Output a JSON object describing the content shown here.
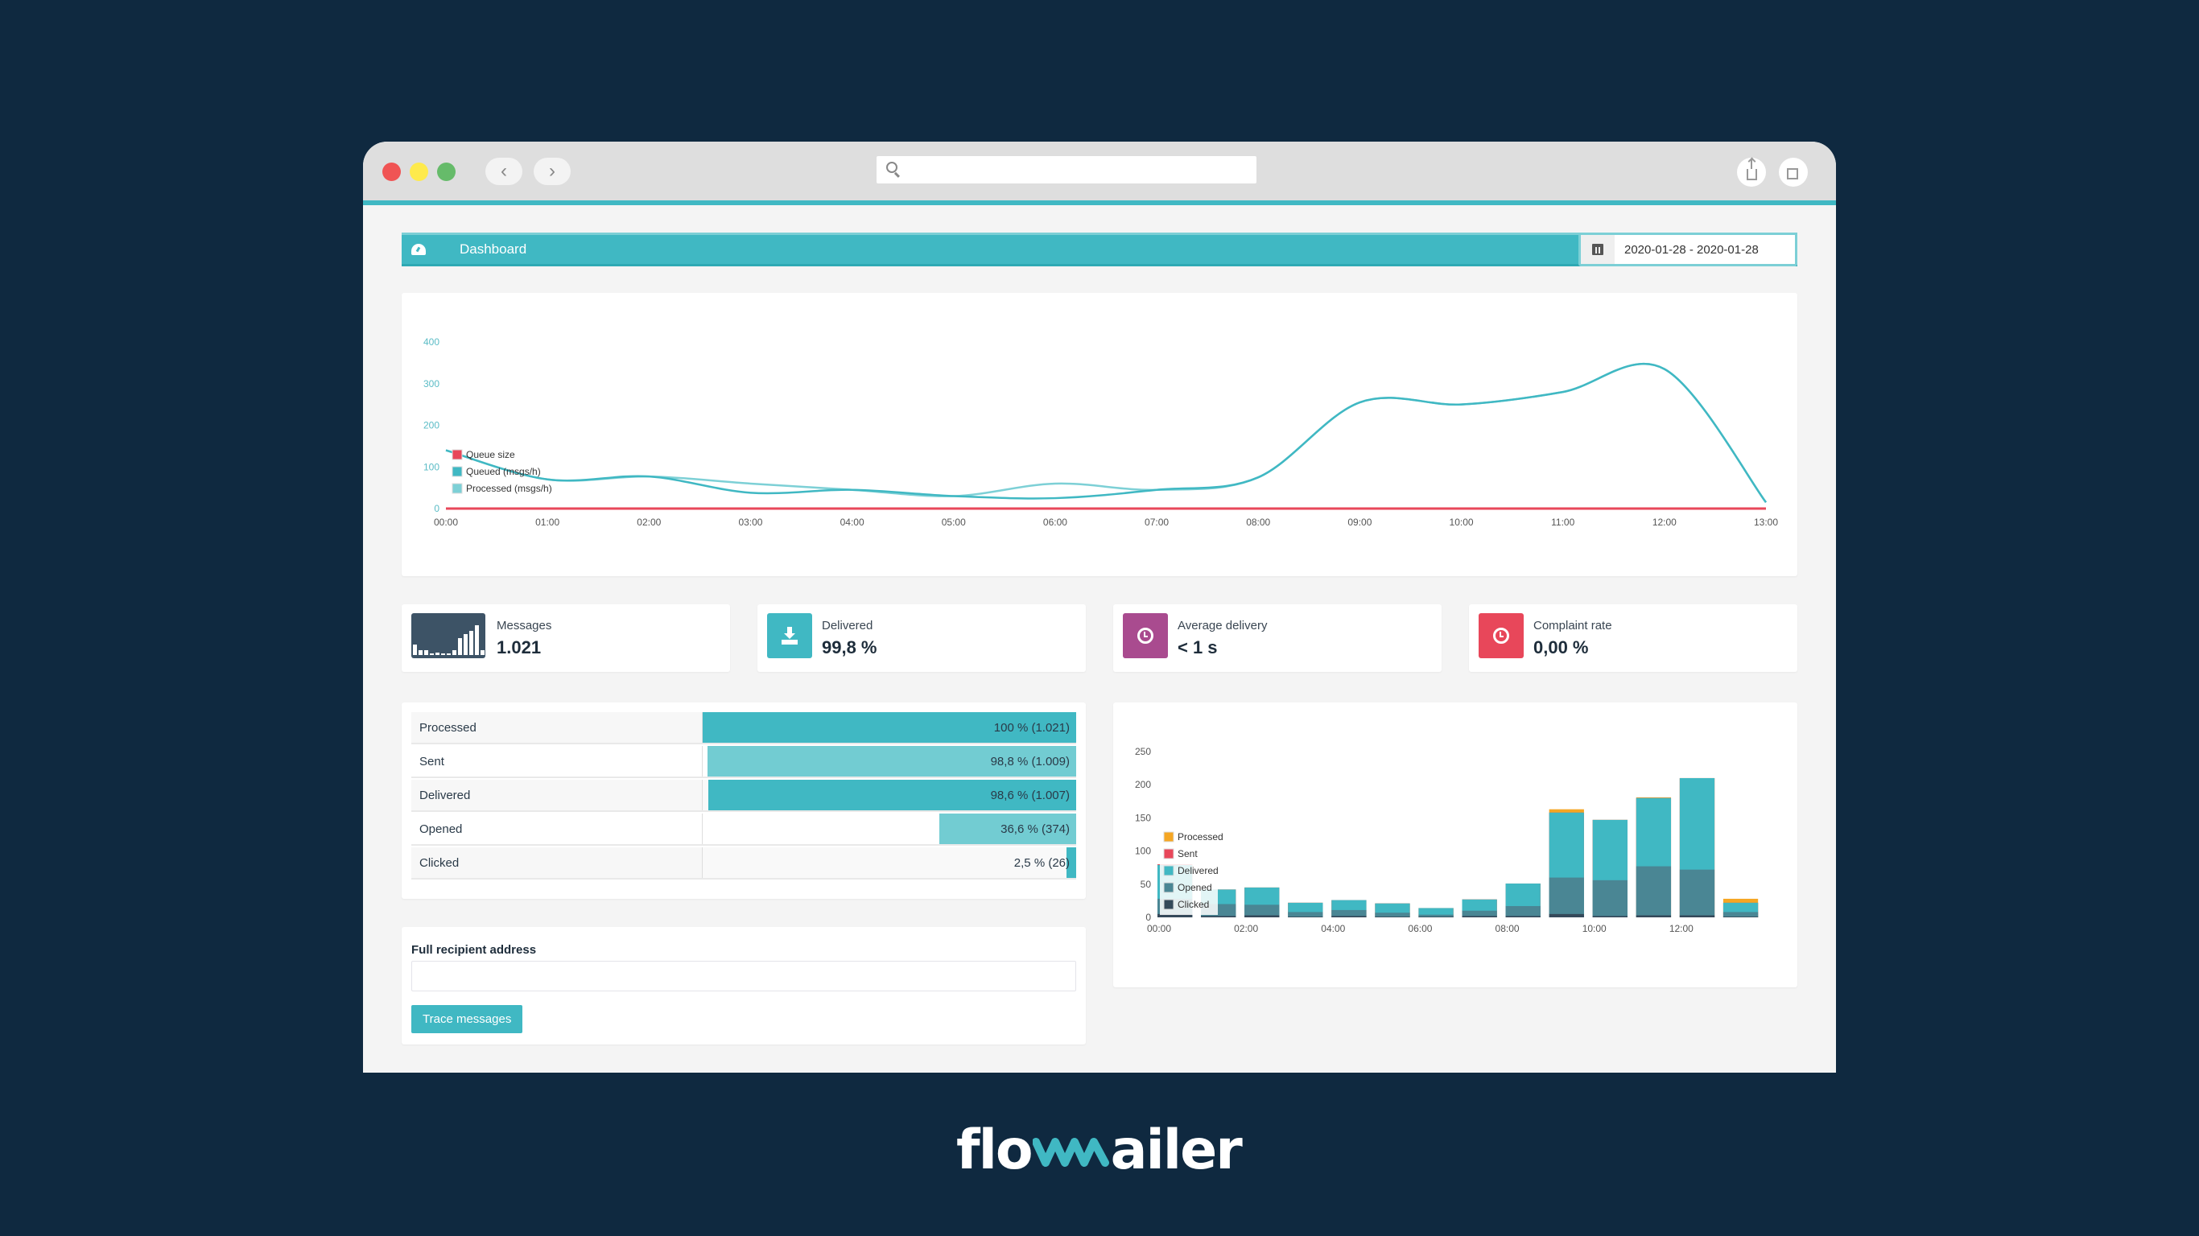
{
  "browser": {
    "url": "",
    "nav": {
      "back_icon": "chevron-left",
      "forward_icon": "chevron-right"
    },
    "actions": [
      "share-icon",
      "tabs-icon"
    ]
  },
  "header": {
    "title": "Dashboard",
    "icon": "dashboard-gauge-icon",
    "date_range": "2020-01-28 - 2020-01-28",
    "date_icon": "calendar-icon"
  },
  "stats": [
    {
      "label": "Messages",
      "value": "1.021",
      "icon": "bar-chart-icon",
      "color": "#3d5366"
    },
    {
      "label": "Delivered",
      "value": "99,8 %",
      "icon": "download-icon",
      "color": "#40b8c3"
    },
    {
      "label": "Average delivery",
      "value": "< 1 s",
      "icon": "clock-icon",
      "color": "#a94b8f"
    },
    {
      "label": "Complaint rate",
      "value": "0,00 %",
      "icon": "clock-icon",
      "color": "#e8475a"
    }
  ],
  "funnel": [
    {
      "label": "Processed",
      "percent": 100,
      "text": "100 % (1.021)",
      "color": "#40b8c3"
    },
    {
      "label": "Sent",
      "percent": 98.8,
      "text": "98,8 % (1.009)",
      "color": "#72ccd2"
    },
    {
      "label": "Delivered",
      "percent": 98.6,
      "text": "98,6 % (1.007)",
      "color": "#40b8c3"
    },
    {
      "label": "Opened",
      "percent": 36.6,
      "text": "36,6 % (374)",
      "color": "#72ccd2"
    },
    {
      "label": "Clicked",
      "percent": 2.5,
      "text": "2,5 % (26)",
      "color": "#40b8c3"
    }
  ],
  "trace": {
    "label": "Full recipient address",
    "value": "",
    "placeholder": "",
    "button": "Trace messages"
  },
  "logo": {
    "pre": "flo",
    "post": "ailer",
    "full": "flowmailer"
  },
  "chart_data": [
    {
      "type": "line",
      "title": "",
      "x": [
        "00:00",
        "01:00",
        "02:00",
        "03:00",
        "04:00",
        "05:00",
        "06:00",
        "07:00",
        "08:00",
        "09:00",
        "10:00",
        "11:00",
        "12:00",
        "13:00"
      ],
      "ylim": [
        0,
        400
      ],
      "yticks": [
        0,
        100,
        200,
        300,
        400
      ],
      "legend_position": "bottom-left",
      "series": [
        {
          "name": "Queue size",
          "color": "#e8475a",
          "values": [
            0,
            0,
            0,
            0,
            0,
            0,
            0,
            0,
            0,
            0,
            0,
            0,
            0,
            0
          ]
        },
        {
          "name": "Queued (msgs/h)",
          "color": "#40b8c3",
          "values": [
            140,
            70,
            77,
            38,
            45,
            30,
            25,
            45,
            75,
            255,
            250,
            280,
            335,
            15
          ]
        },
        {
          "name": "Processed (msgs/h)",
          "color": "#7dd0d6",
          "values": [
            140,
            70,
            77,
            60,
            45,
            30,
            60,
            45,
            75,
            255,
            250,
            280,
            335,
            15
          ]
        }
      ]
    },
    {
      "type": "bar",
      "stacked": true,
      "title": "",
      "categories": [
        "00:00",
        "01:00",
        "02:00",
        "03:00",
        "04:00",
        "05:00",
        "06:00",
        "07:00",
        "08:00",
        "09:00",
        "10:00",
        "11:00",
        "12:00",
        "13:00"
      ],
      "xticks": [
        "00:00",
        "02:00",
        "04:00",
        "06:00",
        "08:00",
        "10:00",
        "12:00"
      ],
      "ylim": [
        0,
        250
      ],
      "yticks": [
        0,
        50,
        100,
        150,
        200,
        250
      ],
      "legend_position": "bottom-left",
      "series": [
        {
          "name": "Processed",
          "color": "#f5a623",
          "values": [
            80,
            42,
            45,
            22,
            26,
            21,
            14,
            27,
            51,
            163,
            147,
            181,
            210,
            28
          ]
        },
        {
          "name": "Sent",
          "color": "#e8475a",
          "values": [
            80,
            42,
            45,
            22,
            26,
            21,
            14,
            27,
            51,
            158,
            147,
            180,
            210,
            22
          ]
        },
        {
          "name": "Delivered",
          "color": "#40b8c3",
          "values": [
            79,
            42,
            45,
            22,
            26,
            21,
            14,
            27,
            51,
            158,
            147,
            180,
            210,
            22
          ]
        },
        {
          "name": "Opened",
          "color": "#4a8694",
          "values": [
            28,
            20,
            19,
            8,
            11,
            7,
            4,
            10,
            17,
            60,
            56,
            77,
            72,
            8
          ]
        },
        {
          "name": "Clicked",
          "color": "#35495a",
          "values": [
            5,
            2,
            3,
            1,
            2,
            1,
            1,
            2,
            2,
            5,
            2,
            3,
            3,
            1
          ]
        }
      ]
    }
  ]
}
